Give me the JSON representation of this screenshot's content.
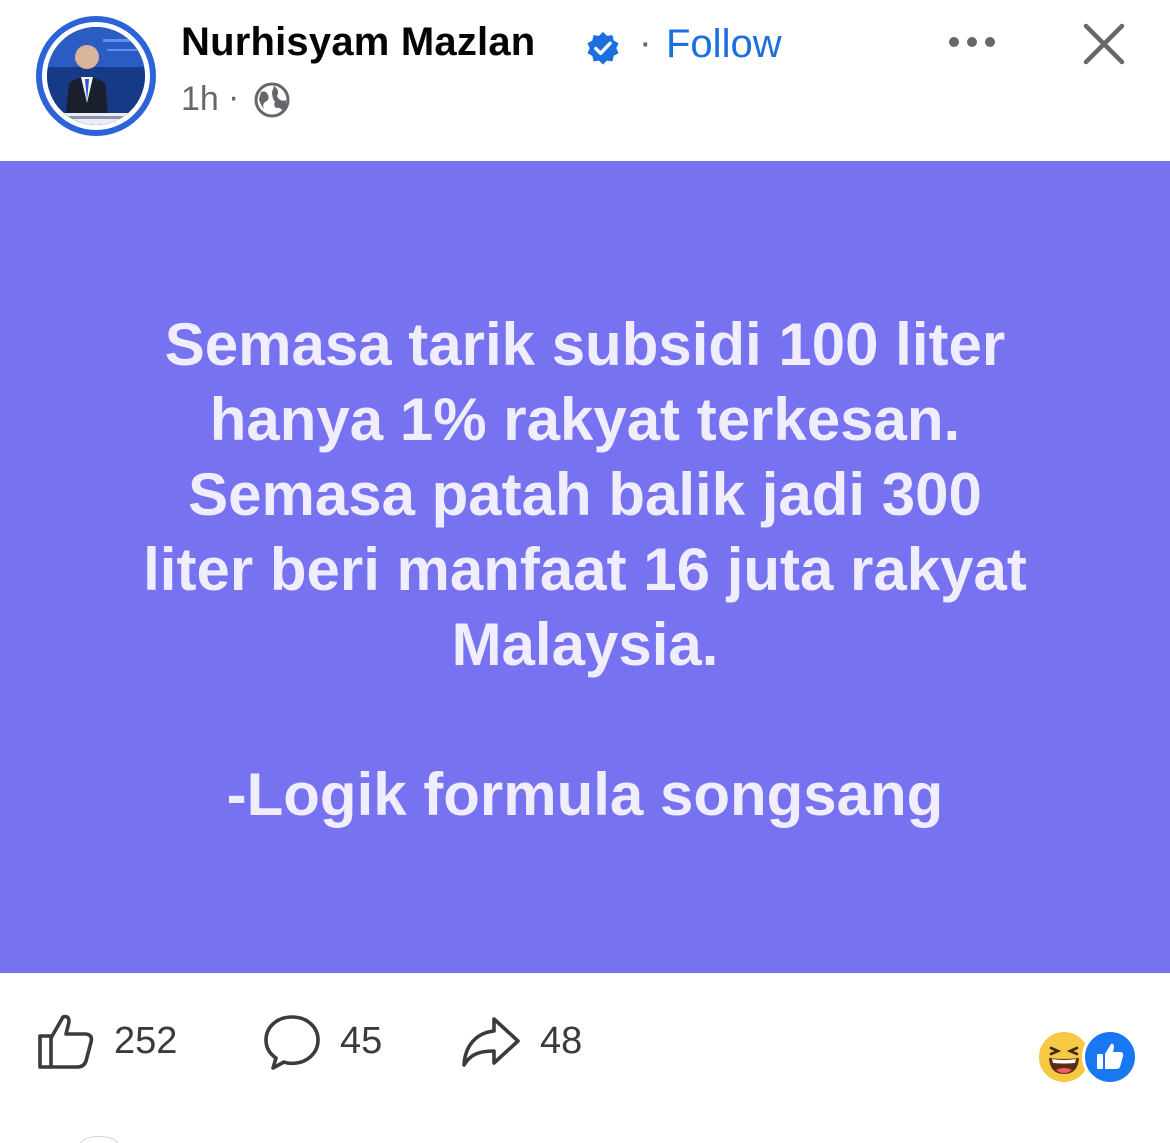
{
  "post": {
    "author": {
      "name": "Nurhisyam Mazlan",
      "verified": true,
      "follow_label": "Follow",
      "separator": "·"
    },
    "meta": {
      "time": "1h",
      "separator": "·",
      "audience_icon": "globe-icon"
    },
    "header_actions": {
      "more_icon": "more-icon",
      "close_icon": "close-icon"
    },
    "text_card": {
      "background_color": "#7672f0",
      "text_color": "#f0eefe",
      "lines": [
        "Semasa tarik subsidi 100 liter",
        "hanya 1% rakyat terkesan.",
        "Semasa patah balik jadi 300",
        "liter beri manfaat 16 juta rakyat",
        "Malaysia.",
        "",
        "-Logik formula songsang"
      ]
    },
    "footer": {
      "like_count": "252",
      "comment_count": "45",
      "share_count": "48",
      "reactions": [
        "haha",
        "like"
      ]
    }
  },
  "colors": {
    "accent": "#1b6fde",
    "verified": "#1b6fde",
    "muted": "#65676b"
  }
}
